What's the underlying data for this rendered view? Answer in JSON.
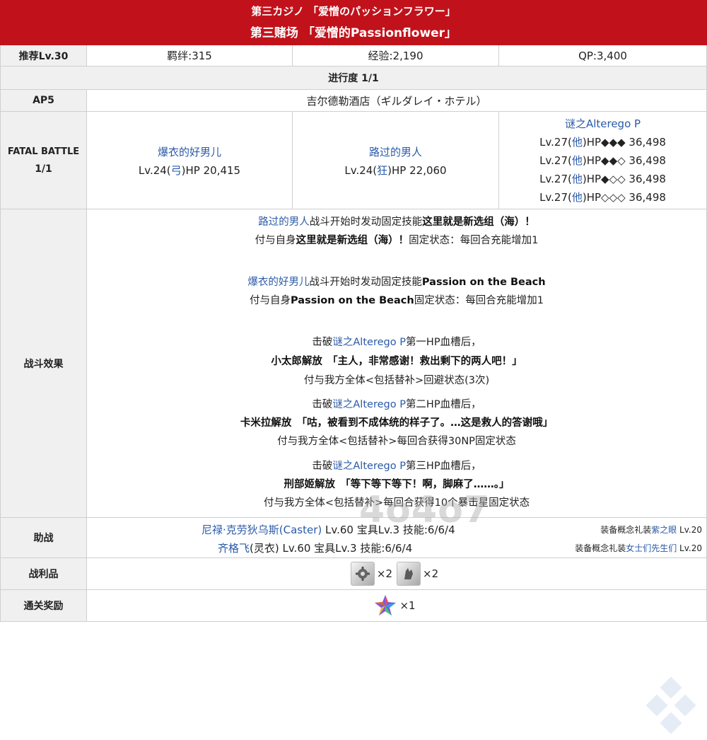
{
  "header": {
    "title_jp": "第三カジノ 「爱憎のパッションフラワー」",
    "title_cn": "第三赌场 「爱憎的Passionflower」"
  },
  "stats": {
    "recommend": "推荐Lv.30",
    "bond": "羁绊:315",
    "exp": "经验:2,190",
    "qp": "QP:3,400"
  },
  "progress": "进行度 1/1",
  "ap": {
    "label": "AP5",
    "location": "吉尔德勒酒店（ギルダレイ・ホテル）"
  },
  "fatal": {
    "label_1": "FATAL BATTLE",
    "label_2": "1/1",
    "enemies": [
      {
        "name": "爆衣的好男儿",
        "lv": "Lv.24(",
        "cls": "弓",
        "hp": ")HP 20,415"
      },
      {
        "name": "路过的男人",
        "lv": "Lv.24(",
        "cls": "狂",
        "hp": ")HP 22,060"
      },
      {
        "name": "谜之Alterego P",
        "bars": [
          {
            "lv": "Lv.27(",
            "cls": "他",
            "hp": ")HP◆◆◆ 36,498"
          },
          {
            "lv": "Lv.27(",
            "cls": "他",
            "hp": ")HP◆◆◇ 36,498"
          },
          {
            "lv": "Lv.27(",
            "cls": "他",
            "hp": ")HP◆◇◇ 36,498"
          },
          {
            "lv": "Lv.27(",
            "cls": "他",
            "hp": ")HP◇◇◇ 36,498"
          }
        ]
      }
    ]
  },
  "effects": {
    "label": "战斗效果",
    "e1a_name": "路过的男人",
    "e1a_text": "战斗开始时发动固定技能",
    "e1a_skill": "这里就是新选组（海）！",
    "e1b_pre": "付与自身",
    "e1b_skill": "这里就是新选组（海）！",
    "e1b_post": "固定状态：每回合充能增加1",
    "e2a_name": "爆衣的好男儿",
    "e2a_text": "战斗开始时发动固定技能",
    "e2a_skill": "Passion on the Beach",
    "e2b_pre": "付与自身",
    "e2b_skill": "Passion on the Beach",
    "e2b_post": "固定状态：每回合充能增加1",
    "b1_pre": "击破",
    "b1_name": "谜之Alterego P",
    "b1_post": "第一HP血槽后，",
    "b1_quote": "小太郎解放　「主人，非常感谢！救出剩下的两人吧！」",
    "b1_eff": "付与我方全体<包括替补>回避状态(3次)",
    "b2_pre": "击破",
    "b2_name": "谜之Alterego P",
    "b2_post": "第二HP血槽后，",
    "b2_quote": "卡米拉解放　「咕，被看到不成体统的样子了。…这是救人的答谢哦」",
    "b2_eff": "付与我方全体<包括替补>每回合获得30NP固定状态",
    "b3_pre": "击破",
    "b3_name": "谜之Alterego P",
    "b3_post": "第三HP血槽后，",
    "b3_quote": "刑部姬解放　「等下等下等下！啊，脚麻了……。」",
    "b3_eff": "付与我方全体<包括替补>每回合获得10个暴击星固定状态"
  },
  "support": {
    "label": "助战",
    "s1_name": "尼禄·克劳狄乌斯(Caster)",
    "s1_info": " Lv.60 宝具Lv.3 技能:6/6/4",
    "s2_name": "齐格飞",
    "s2_info": "(灵衣) Lv.60 宝具Lv.3 技能:6/6/4",
    "ce1_pre": "装备概念礼装",
    "ce1_name": "紫之眼",
    "ce1_lv": " Lv.20",
    "ce2_pre": "装备概念礼装",
    "ce2_name": "女士们先生们",
    "ce2_lv": " Lv.20"
  },
  "loot": {
    "label": "战利品",
    "items": [
      {
        "icon": "gear-material-icon",
        "qty": "×2"
      },
      {
        "icon": "hand-material-icon",
        "qty": "×2"
      }
    ]
  },
  "reward": {
    "label": "通关奖励",
    "icon": "saint-quartz-icon",
    "qty": "×1"
  },
  "watermark": "4o4o7",
  "colors": {
    "header": "#c1121b",
    "link": "#2a5aa8",
    "label_bg": "#f0f0f0"
  }
}
